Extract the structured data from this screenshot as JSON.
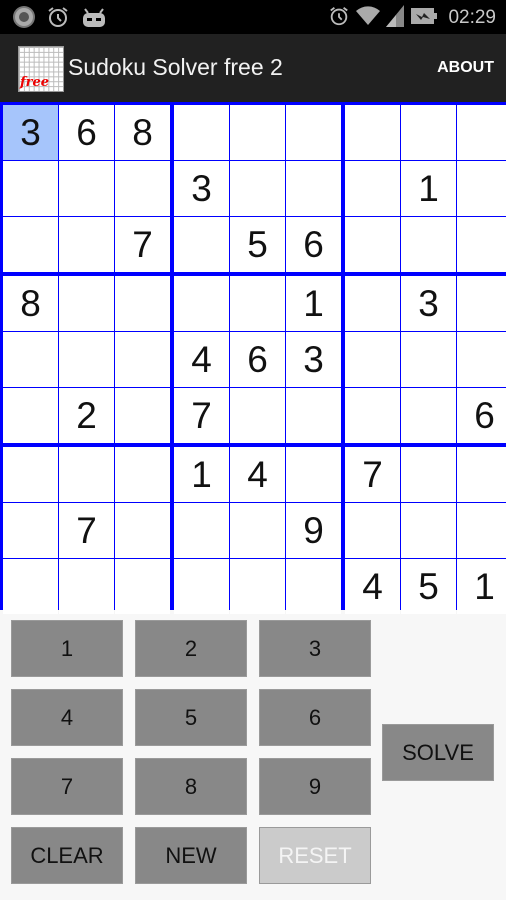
{
  "status_bar": {
    "left_icons": [
      "record-icon",
      "alarm-icon",
      "android-icon"
    ],
    "right_icons": [
      "alarm-icon",
      "wifi-icon",
      "signal-icon",
      "battery-charging-icon"
    ],
    "time": "02:29"
  },
  "action_bar": {
    "app_icon_label": "free",
    "title": "Sudoku Solver free 2",
    "about_label": "ABOUT"
  },
  "board": {
    "selected": [
      0,
      0
    ],
    "rows": [
      [
        "3",
        "6",
        "8",
        "",
        "",
        "",
        "",
        "",
        ""
      ],
      [
        "",
        "",
        "",
        "3",
        "",
        "",
        "",
        "1",
        ""
      ],
      [
        "",
        "",
        "7",
        "",
        "5",
        "6",
        "",
        "",
        ""
      ],
      [
        "8",
        "",
        "",
        "",
        "",
        "1",
        "",
        "3",
        ""
      ],
      [
        "",
        "",
        "",
        "4",
        "6",
        "3",
        "",
        "",
        ""
      ],
      [
        "",
        "2",
        "",
        "7",
        "",
        "",
        "",
        "",
        "6"
      ],
      [
        "",
        "",
        "",
        "1",
        "4",
        "",
        "7",
        "",
        ""
      ],
      [
        "",
        "7",
        "",
        "",
        "",
        "9",
        "",
        "",
        ""
      ],
      [
        "",
        "",
        "",
        "",
        "",
        "",
        "4",
        "5",
        "1"
      ]
    ],
    "colors": {
      "grid_line": "#0000ff",
      "selected_cell": "#a6c5fb"
    }
  },
  "keypad": {
    "digits": [
      "1",
      "2",
      "3",
      "4",
      "5",
      "6",
      "7",
      "8",
      "9"
    ],
    "clear_label": "CLEAR",
    "new_label": "NEW",
    "reset_label": "RESET",
    "reset_enabled": false,
    "solve_label": "SOLVE"
  }
}
